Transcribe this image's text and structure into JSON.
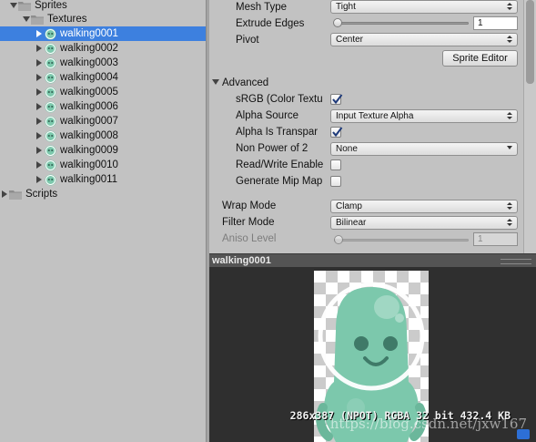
{
  "tree": {
    "sprites_label": "Sprites",
    "textures_label": "Textures",
    "scripts_label": "Scripts",
    "items": [
      "walking0001",
      "walking0002",
      "walking0003",
      "walking0004",
      "walking0005",
      "walking0006",
      "walking0007",
      "walking0008",
      "walking0009",
      "walking0010",
      "walking0011"
    ],
    "selected_index": 0,
    "icons": {
      "folder": "folder-icon",
      "sprite": "sprite-asset-icon",
      "expand": "triangle-icon"
    }
  },
  "inspector": {
    "mesh_type": {
      "label": "Mesh Type",
      "value": "Tight"
    },
    "extrude_edges": {
      "label": "Extrude Edges",
      "value": "1",
      "slider_fraction": 0.0
    },
    "pivot": {
      "label": "Pivot",
      "value": "Center"
    },
    "sprite_editor_button": "Sprite Editor",
    "advanced": {
      "label": "Advanced",
      "expanded": true
    },
    "srgb": {
      "label": "sRGB (Color Textu",
      "checked": true
    },
    "alpha_source": {
      "label": "Alpha Source",
      "value": "Input Texture Alpha"
    },
    "alpha_is_transparency": {
      "label": "Alpha Is Transpar",
      "checked": true
    },
    "non_power_of_2": {
      "label": "Non Power of 2",
      "value": "None"
    },
    "read_write": {
      "label": "Read/Write Enable",
      "checked": false
    },
    "generate_mip": {
      "label": "Generate Mip Map",
      "checked": false
    },
    "wrap_mode": {
      "label": "Wrap Mode",
      "value": "Clamp"
    },
    "filter_mode": {
      "label": "Filter Mode",
      "value": "Bilinear"
    },
    "aniso_level": {
      "label": "Aniso Level",
      "value": "1",
      "slider_fraction": 0.0,
      "disabled": true
    }
  },
  "preview": {
    "title": "walking0001",
    "info": "286x387 (NPOT)  RGBA 32 bit  432.4 KB",
    "watermark": "https://blog.csdn.net/jxw167",
    "sprite_color": "#7cc8ac"
  },
  "colors": {
    "selection": "#3d80df",
    "panel": "#c2c2c2",
    "preview_bg": "#2f2f2f"
  }
}
